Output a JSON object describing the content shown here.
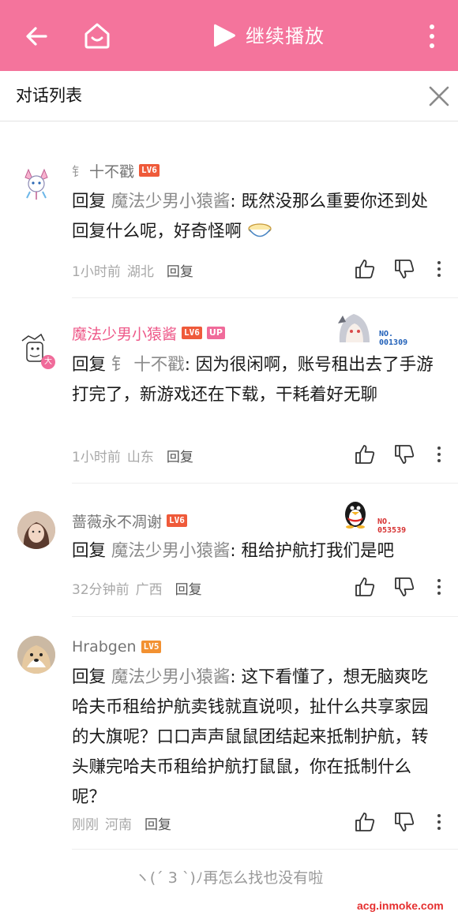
{
  "topbar": {
    "title": "继续播放",
    "icons": [
      "back-arrow-icon",
      "home-tv-icon",
      "play-icon",
      "more-vertical-icon"
    ],
    "accent": "#f4749c"
  },
  "subhead": {
    "label": "对话列表",
    "close_icon": "close-icon"
  },
  "comments": [
    {
      "prefix": "钅",
      "username": "十不戳",
      "level": "LV6",
      "reply_word": "回复",
      "reply_target": "魔法少男小猿酱",
      "content": ": 既然没那么重要你还到处回复什么呢，好奇怪啊",
      "time": "1小时前",
      "location": "湖北",
      "reply_label": "回复"
    },
    {
      "username": "魔法少男小猿酱",
      "level": "LV6",
      "up_tag": "UP",
      "badge_no": "NO.\n001309",
      "reply_word": "回复",
      "reply_target": "钅 十不戳",
      "content": ": 因为很闲啊，账号租出去了手游打完了，新游戏还在下载，干耗着好无聊",
      "time": "1小时前",
      "location": "山东",
      "reply_label": "回复",
      "avatar_badge": "大"
    },
    {
      "username": "蔷薇永不凋谢",
      "level": "LV6",
      "badge_no": "NO.\n053539",
      "reply_word": "回复",
      "reply_target": "魔法少男小猿酱",
      "content": ": 租给护航打我们是吧",
      "time": "32分钟前",
      "location": "广西",
      "reply_label": "回复"
    },
    {
      "username": "Hrabgen",
      "level": "LV5",
      "reply_word": "回复",
      "reply_target": "魔法少男小猿酱",
      "content": ": 这下看懂了，想无脑爽吃哈夫币租给护航卖钱就直说呗，扯什么共享家园的大旗呢？口口声声鼠鼠团结起来抵制护航，转头赚完哈夫币租给护航打鼠鼠，你在抵制什么呢？",
      "time": "刚刚",
      "location": "河南",
      "reply_label": "回复"
    }
  ],
  "footer": {
    "end_text": "ヽ(´ 3 `)ﾉ再怎么找也没有啦"
  },
  "watermark": "acg.inmoke.com"
}
